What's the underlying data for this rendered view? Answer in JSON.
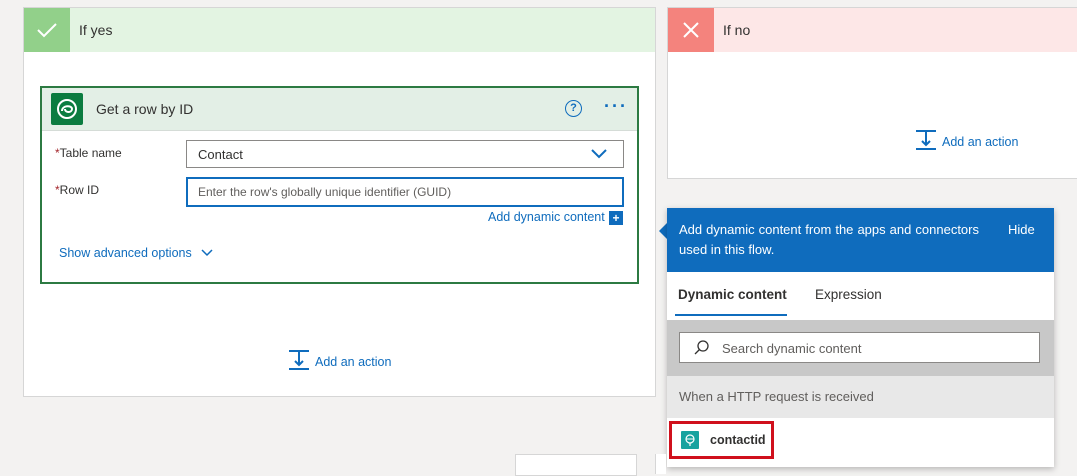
{
  "branches": {
    "yes": {
      "title": "If yes",
      "add_action": "Add an action"
    },
    "no": {
      "title": "If no",
      "add_action": "Add an action"
    }
  },
  "action": {
    "title": "Get a row by ID",
    "help_icon_glyph": "?",
    "more_icon_glyph": "···",
    "fields": {
      "table": {
        "required": "*",
        "label": "Table name",
        "value": "Contact"
      },
      "row_id": {
        "required": "*",
        "label": "Row ID",
        "placeholder": "Enter the row's globally unique identifier (GUID)"
      }
    },
    "add_dynamic_content": "Add dynamic content",
    "plus_glyph": "+",
    "show_advanced": "Show advanced options"
  },
  "dynamic_panel": {
    "description": "Add dynamic content from the apps and connectors used in this flow.",
    "hide": "Hide",
    "tabs": [
      {
        "label": "Dynamic content",
        "active": true
      },
      {
        "label": "Expression",
        "active": false
      }
    ],
    "search_placeholder": "Search dynamic content",
    "section_title": "When a HTTP request is received",
    "tokens": [
      {
        "label": "contactid",
        "icon": "http-request-icon",
        "color": "#17a29f"
      }
    ]
  },
  "colors": {
    "accent": "#0f6cbd",
    "yes_header": "#e3f4e2",
    "yes_icon": "#92d08a",
    "no_header": "#fde7e7",
    "no_icon": "#f4837d",
    "card_border": "#2c7a42",
    "highlight": "#d0101c"
  },
  "icons": {
    "yes": "checkmark-icon",
    "no": "close-icon",
    "connector": "dataverse-icon",
    "add_action": "add-action-icon",
    "search": "search-icon",
    "chevron": "chevron-down-icon"
  }
}
